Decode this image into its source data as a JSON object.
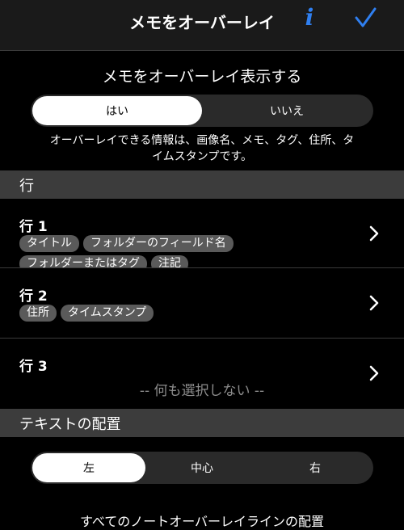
{
  "header": {
    "title": "メモをオーバーレイ",
    "info_label": "i"
  },
  "overlay": {
    "title": "メモをオーバーレイ表示する",
    "options": [
      "はい",
      "いいえ"
    ],
    "selected": "はい",
    "description_line1": "オーバーレイできる情報は、画像名、メモ、タグ、住所、タ",
    "description_line2": "イムスタンプです。"
  },
  "lines_section": {
    "title": "行"
  },
  "rows": [
    {
      "label": "行 1",
      "tags": [
        "タイトル",
        "フォルダーのフィールド名",
        "フォルダーまたはタグ",
        "注記"
      ]
    },
    {
      "label": "行 2",
      "tags": [
        "住所",
        "タイムスタンプ"
      ]
    },
    {
      "label": "行 3",
      "empty_text": "-- 何も選択しない --"
    }
  ],
  "alignment_section": {
    "title": "テキストの配置"
  },
  "alignment": {
    "options": [
      "左",
      "中心",
      "右"
    ],
    "selected": "左"
  },
  "footer": {
    "text": "すべてのノートオーバーレイラインの配置"
  },
  "colors": {
    "accent": "#2f7ff0",
    "section_bg": "#3c3c3c",
    "tag_bg": "#5a5a5a"
  }
}
